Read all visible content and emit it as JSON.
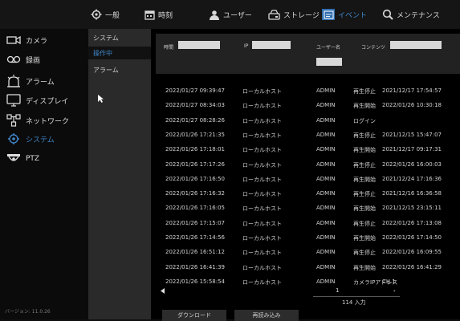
{
  "tabs": [
    {
      "label": "一般",
      "icon": "gear-icon"
    },
    {
      "label": "時刻",
      "icon": "calendar-icon"
    },
    {
      "label": "ユーザー",
      "icon": "users-icon"
    },
    {
      "label": "ストレージ",
      "icon": "storage-icon"
    },
    {
      "label": "イベント",
      "icon": "event-icon",
      "active": true
    },
    {
      "label": "メンテナンス",
      "icon": "maintenance-icon"
    }
  ],
  "sidebar": {
    "items": [
      {
        "label": "カメラ",
        "icon": "camera-icon"
      },
      {
        "label": "録画",
        "icon": "record-icon"
      },
      {
        "label": "アラーム",
        "icon": "alarm-icon"
      },
      {
        "label": "ディスプレイ",
        "icon": "display-icon"
      },
      {
        "label": "ネットワーク",
        "icon": "network-icon"
      },
      {
        "label": "システム",
        "icon": "system-icon",
        "active": true
      },
      {
        "label": "PTZ",
        "icon": "ptz-camera-icon"
      }
    ],
    "version": "バージョン: 11.0.26"
  },
  "subpanel": {
    "items": [
      {
        "label": "システム"
      },
      {
        "label": "操作中",
        "active": true
      },
      {
        "label": "アラーム"
      }
    ]
  },
  "filter": {
    "time_label": "時間",
    "ip_label": "IP",
    "user_label": "ユーザー名",
    "content_label": "コンテンツ"
  },
  "log": {
    "rows": [
      {
        "time": "2022/01/27 09:39:47",
        "host": "ローカルホスト",
        "user": "ADMIN",
        "action": "再生停止",
        "detail": "2021/12/17 17:54:57"
      },
      {
        "time": "2022/01/27 08:34:03",
        "host": "ローカルホスト",
        "user": "ADMIN",
        "action": "再生開始",
        "detail": "2022/01/26 10:30:18"
      },
      {
        "time": "2022/01/27 08:28:26",
        "host": "ローカルホスト",
        "user": "ADMIN",
        "action": "ログイン",
        "detail": ""
      },
      {
        "time": "2022/01/26 17:21:35",
        "host": "ローカルホスト",
        "user": "ADMIN",
        "action": "再生停止",
        "detail": "2021/12/15 15:47:07"
      },
      {
        "time": "2022/01/26 17:18:01",
        "host": "ローカルホスト",
        "user": "ADMIN",
        "action": "再生開始",
        "detail": "2021/12/17 09:17:31"
      },
      {
        "time": "2022/01/26 17:17:26",
        "host": "ローカルホスト",
        "user": "ADMIN",
        "action": "再生停止",
        "detail": "2022/01/26 16:00:03"
      },
      {
        "time": "2022/01/26 17:16:50",
        "host": "ローカルホスト",
        "user": "ADMIN",
        "action": "再生開始",
        "detail": "2021/12/24 17:16:36"
      },
      {
        "time": "2022/01/26 17:16:32",
        "host": "ローカルホスト",
        "user": "ADMIN",
        "action": "再生停止",
        "detail": "2021/12/16 16:36:58"
      },
      {
        "time": "2022/01/26 17:16:05",
        "host": "ローカルホスト",
        "user": "ADMIN",
        "action": "再生開始",
        "detail": "2021/12/15 23:15:11"
      },
      {
        "time": "2022/01/26 17:15:07",
        "host": "ローカルホスト",
        "user": "ADMIN",
        "action": "再生停止",
        "detail": "2022/01/26 17:13:08"
      },
      {
        "time": "2022/01/26 17:14:56",
        "host": "ローカルホスト",
        "user": "ADMIN",
        "action": "再生開始",
        "detail": "2022/01/26 17:14:50"
      },
      {
        "time": "2022/01/26 16:51:12",
        "host": "ローカルホスト",
        "user": "ADMIN",
        "action": "再生停止",
        "detail": "2022/01/26 16:09:55"
      },
      {
        "time": "2022/01/26 16:41:39",
        "host": "ローカルホスト",
        "user": "ADMIN",
        "action": "再生開始",
        "detail": "2022/01/26 16:41:29"
      },
      {
        "time": "2022/01/26 15:58:54",
        "host": "ローカルホスト",
        "user": "ADMIN",
        "action": "カメラIPアドレス",
        "detail": "CH.1"
      }
    ]
  },
  "pager": {
    "page": "1",
    "total": "114 入力"
  },
  "buttons": {
    "download": "ダウンロード",
    "reload": "再読み込み"
  }
}
